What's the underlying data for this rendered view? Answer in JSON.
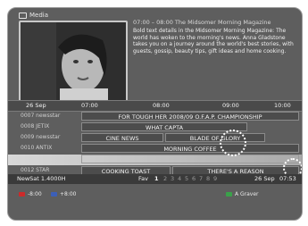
{
  "header": {
    "label": "Media"
  },
  "info": {
    "title": "07:00 – 08:00 The Midsomer Morning Magazine",
    "description": "Bold text details in the Midsomer Morning Magazine: The world has woken to the morning's news. Anna Gladstone takes you on a journey around the world's best stories, with guests, gossip, beauty tips, gift ideas and home cooking."
  },
  "timebar": {
    "date": "26 Sep",
    "times": [
      "07:00",
      "08:00",
      "09:00",
      "10:00"
    ]
  },
  "channels": [
    {
      "name": "0007 newsstar",
      "programs": [
        {
          "title": "FOR TOUGH HER 2008/09 O.F.A.P. CHAMPIONSHIP"
        }
      ]
    },
    {
      "name": "0008 JETIX",
      "programs": [
        {
          "title": "WHAT CAPTA"
        }
      ]
    },
    {
      "name": "0009 newsstar",
      "programs": [
        {
          "title": "CINE NEWS"
        },
        {
          "title": "BLADE OF GLORY"
        }
      ]
    },
    {
      "name": "0010 ANTIX",
      "programs": [
        {
          "title": "MORNING COFFEE"
        }
      ]
    },
    {
      "name": "",
      "programs": [
        {
          "title": ""
        }
      ]
    },
    {
      "name": "0012 STAR",
      "programs": [
        {
          "title": "COOKING TOAST"
        },
        {
          "title": "THERE'S A REASON"
        }
      ]
    }
  ],
  "status": {
    "satellite": "NewSat 1.4000H",
    "fav_label": "Fav",
    "current_page": "1",
    "pages": [
      "2",
      "3",
      "4",
      "5",
      "6",
      "7",
      "8",
      "9"
    ],
    "date": "26 Sep",
    "time": "07:53"
  },
  "footer": {
    "prev": "-8:00",
    "next": "+8:00",
    "action": "A Graver"
  },
  "colors": {
    "btn_red": "#cc2a2a",
    "btn_blue": "#3c5fb8",
    "btn_green": "#3aa14a",
    "page_active": "#ffffff",
    "page_inactive": "#9a9a9a"
  }
}
